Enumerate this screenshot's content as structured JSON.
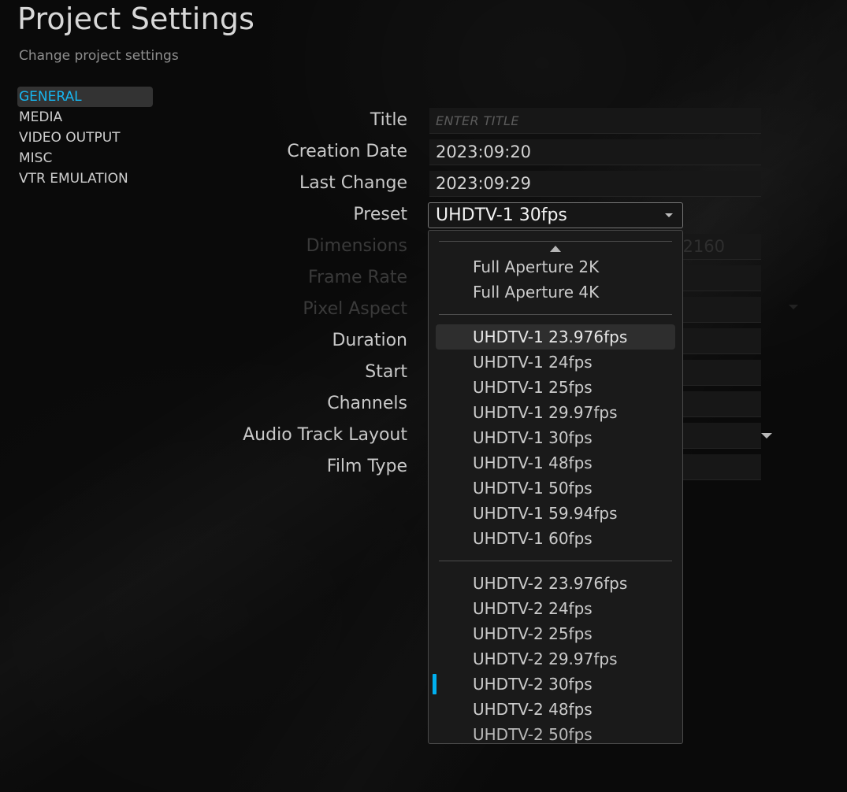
{
  "header": {
    "title": "Project Settings",
    "subtitle": "Change project settings"
  },
  "sidebar": {
    "items": [
      {
        "label": "GENERAL",
        "active": true
      },
      {
        "label": "MEDIA",
        "active": false
      },
      {
        "label": "VIDEO OUTPUT",
        "active": false
      },
      {
        "label": "MISC",
        "active": false
      },
      {
        "label": "VTR EMULATION",
        "active": false
      }
    ]
  },
  "form": {
    "rows": [
      {
        "label": "Title",
        "value": "",
        "placeholder": "ENTER TITLE",
        "disabled": false
      },
      {
        "label": "Creation Date",
        "value": "2023:09:20",
        "placeholder": "",
        "disabled": false
      },
      {
        "label": "Last Change",
        "value": "2023:09:29",
        "placeholder": "",
        "disabled": false
      },
      {
        "label": "Preset",
        "value": "UHDTV-1 30fps",
        "placeholder": "",
        "disabled": false
      },
      {
        "label": "Dimensions",
        "value": "2160",
        "placeholder": "",
        "disabled": true
      },
      {
        "label": "Frame Rate",
        "value": "",
        "placeholder": "",
        "disabled": true
      },
      {
        "label": "Pixel Aspect",
        "value": "",
        "placeholder": "",
        "disabled": true
      },
      {
        "label": "Duration",
        "value": "",
        "placeholder": "",
        "disabled": false
      },
      {
        "label": "Start",
        "value": "",
        "placeholder": "",
        "disabled": false
      },
      {
        "label": "Channels",
        "value": "",
        "placeholder": "",
        "disabled": false
      },
      {
        "label": "Audio Track Layout",
        "value": "",
        "placeholder": "",
        "disabled": false
      },
      {
        "label": "Film Type",
        "value": "",
        "placeholder": "",
        "disabled": false
      }
    ]
  },
  "preset_combo": {
    "value": "UHDTV-1 30fps",
    "caret_icon": "chevron-down-icon",
    "expanded": true
  },
  "preset_popup": {
    "scroll_up_icon": "scroll-up-arrow-icon",
    "scroll_down_icon": "scroll-down-arrow-icon",
    "selected_value": "UHDTV-1 30fps",
    "hovered_value": "UHDTV-1 23.976fps",
    "selection_marker_color": "#00b0f0",
    "groups": [
      {
        "items": [
          {
            "label": "Full Aperture 2K",
            "hovered": false,
            "selected": false
          },
          {
            "label": "Full Aperture 4K",
            "hovered": false,
            "selected": false
          }
        ]
      },
      {
        "items": [
          {
            "label": "UHDTV-1 23.976fps",
            "hovered": true,
            "selected": false
          },
          {
            "label": "UHDTV-1 24fps",
            "hovered": false,
            "selected": false
          },
          {
            "label": "UHDTV-1 25fps",
            "hovered": false,
            "selected": false
          },
          {
            "label": "UHDTV-1 29.97fps",
            "hovered": false,
            "selected": false
          },
          {
            "label": "UHDTV-1 30fps",
            "hovered": false,
            "selected": true
          },
          {
            "label": "UHDTV-1 48fps",
            "hovered": false,
            "selected": false
          },
          {
            "label": "UHDTV-1 50fps",
            "hovered": false,
            "selected": false
          },
          {
            "label": "UHDTV-1 59.94fps",
            "hovered": false,
            "selected": false
          },
          {
            "label": "UHDTV-1 60fps",
            "hovered": false,
            "selected": false
          }
        ]
      },
      {
        "items": [
          {
            "label": "UHDTV-2 23.976fps",
            "hovered": false,
            "selected": false
          },
          {
            "label": "UHDTV-2 24fps",
            "hovered": false,
            "selected": false
          },
          {
            "label": "UHDTV-2 25fps",
            "hovered": false,
            "selected": false
          },
          {
            "label": "UHDTV-2 29.97fps",
            "hovered": false,
            "selected": false
          },
          {
            "label": "UHDTV-2 30fps",
            "hovered": false,
            "selected": false
          },
          {
            "label": "UHDTV-2 48fps",
            "hovered": false,
            "selected": false
          },
          {
            "label": "UHDTV-2 50fps",
            "hovered": false,
            "selected": false,
            "clipped": true
          }
        ]
      }
    ]
  }
}
